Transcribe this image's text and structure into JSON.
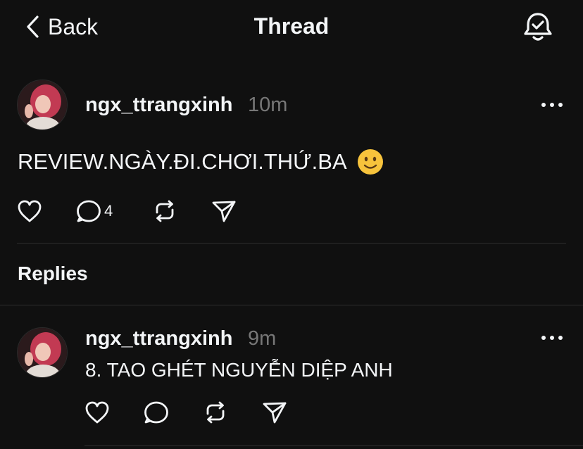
{
  "header": {
    "back_label": "Back",
    "title": "Thread",
    "bell_icon": "bell-check-icon"
  },
  "post": {
    "username": "ngx_ttrangxinh",
    "time": "10m",
    "text": "REVIEW.NGÀY.ĐI.CHƠI.THỨ.BA",
    "emoji": "slightly-smiling-face-emoji",
    "reply_count": "4"
  },
  "replies": {
    "heading": "Replies",
    "items": [
      {
        "username": "ngx_ttrangxinh",
        "time": "9m",
        "text": "8. TAO GHÉT NGUYỄN DIỆP ANH"
      }
    ]
  },
  "theme": {
    "background": "#101010",
    "text": "#f3f5f7",
    "muted": "#777777",
    "divider": "#2e2e2e"
  }
}
